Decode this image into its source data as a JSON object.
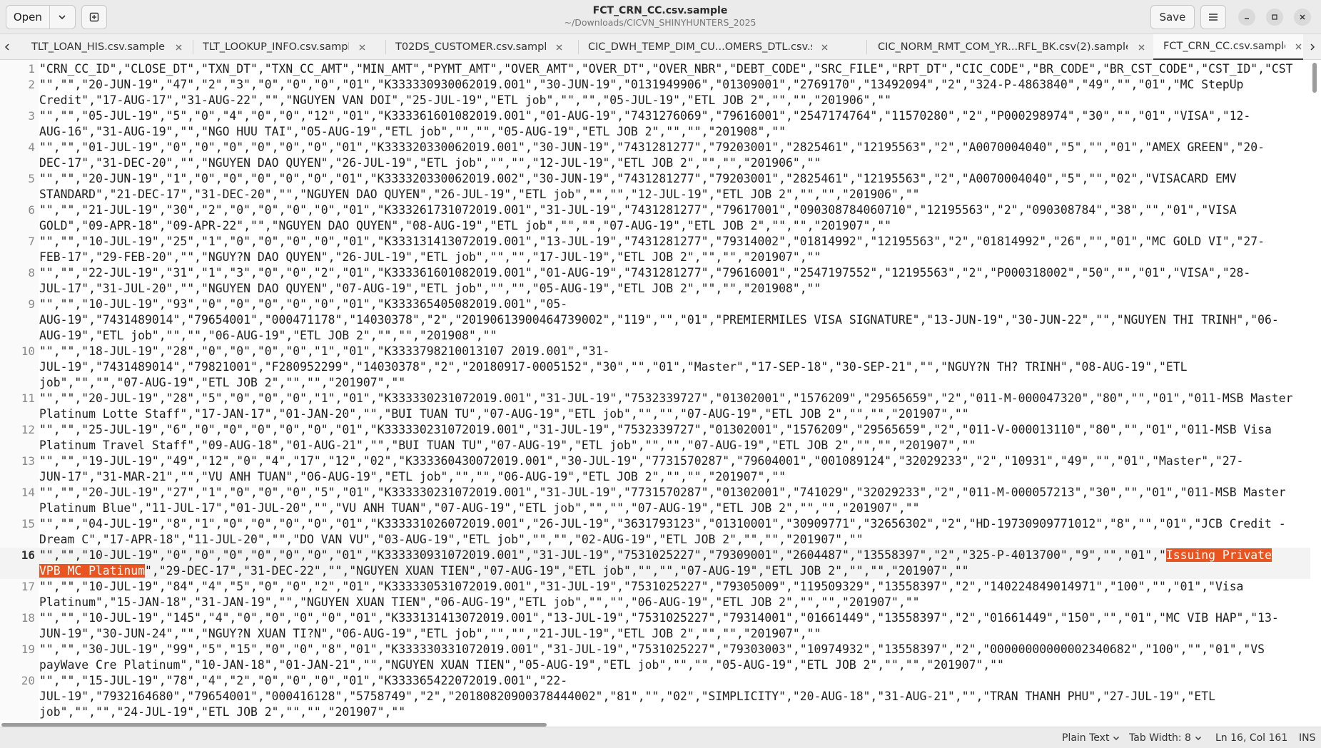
{
  "header": {
    "open_label": "Open",
    "save_label": "Save",
    "title": "FCT_CRN_CC.csv.sample",
    "path": "~/Downloads/CICVN_SHINYHUNTERS_2025"
  },
  "tabs": [
    {
      "label": "TLT_LOAN_HIS.csv.sample",
      "active": false
    },
    {
      "label": "TLT_LOOKUP_INFO.csv.sample",
      "active": false
    },
    {
      "label": "T02DS_CUSTOMER.csv.sample",
      "active": false
    },
    {
      "label": "CIC_DWH_TEMP_DIM_CU...OMERS_DTL.csv.sample",
      "active": false
    },
    {
      "label": "CIC_NORM_RMT_COM_YR...RFL_BK.csv(2).sample",
      "active": false
    },
    {
      "label": "FCT_CRN_CC.csv.sample",
      "active": true
    }
  ],
  "editor": {
    "current_line": 16,
    "lines": [
      {
        "n": "1",
        "segs": [
          "\"CRN_CC_ID\",\"CLOSE_DT\",\"TXN_DT\",\"TXN_CC_AMT\",\"MIN_AMT\",\"PYMT_AMT\",\"OVER_AMT\",\"OVER_DT\",\"OVER_NBR\",\"DEBT_CODE\",\"SRC_FILE\",\"RPT_DT\",\"CIC_CODE\",\"BR_CODE\",\"BR_CST_CODE\",\"CST_ID\",\"CST"
        ]
      },
      {
        "n": "2",
        "segs": [
          "\"\",\"\",\"20-JUN-19\",\"47\",\"2\",\"3\",\"0\",\"0\",\"0\",\"01\",\"K333330930062019.001\",\"30-JUN-19\",\"0131949906\",\"01309001\",\"2769170\",\"13492094\",\"2\",\"324-P-4863840\",\"49\",\"\",\"01\",\"MC StepUp",
          "Credit\",\"17-AUG-17\",\"31-AUG-22\",\"\",\"NGUYEN VAN DOI\",\"25-JUL-19\",\"ETL job\",\"\",\"\",\"05-JUL-19\",\"ETL JOB 2\",\"\",\"\",\"201906\",\"\""
        ]
      },
      {
        "n": "3",
        "segs": [
          "\"\",\"\",\"05-JUL-19\",\"5\",\"0\",\"4\",\"0\",\"0\",\"12\",\"01\",\"K333361601082019.001\",\"01-AUG-19\",\"7431276069\",\"79616001\",\"2547174764\",\"11570280\",\"2\",\"P000298974\",\"30\",\"\",\"01\",\"VISA\",\"12-",
          "AUG-16\",\"31-AUG-19\",\"\",\"NGO HUU TAI\",\"05-AUG-19\",\"ETL job\",\"\",\"\",\"05-AUG-19\",\"ETL JOB 2\",\"\",\"\",\"201908\",\"\""
        ]
      },
      {
        "n": "4",
        "segs": [
          "\"\",\"\",\"01-JUL-19\",\"0\",\"0\",\"0\",\"0\",\"0\",\"0\",\"01\",\"K333320330062019.001\",\"30-JUN-19\",\"7431281277\",\"79203001\",\"2825461\",\"12195563\",\"2\",\"A0070004040\",\"5\",\"\",\"01\",\"AMEX GREEN\",\"20-",
          "DEC-17\",\"31-DEC-20\",\"\",\"NGUYEN DAO QUYEN\",\"26-JUL-19\",\"ETL job\",\"\",\"\",\"12-JUL-19\",\"ETL JOB 2\",\"\",\"\",\"201906\",\"\""
        ]
      },
      {
        "n": "5",
        "segs": [
          "\"\",\"\",\"20-JUN-19\",\"1\",\"0\",\"0\",\"0\",\"0\",\"0\",\"01\",\"K333320330062019.002\",\"30-JUN-19\",\"7431281277\",\"79203001\",\"2825461\",\"12195563\",\"2\",\"A0070004040\",\"5\",\"\",\"02\",\"VISACARD EMV",
          "STANDARD\",\"21-DEC-17\",\"31-DEC-20\",\"\",\"NGUYEN DAO QUYEN\",\"26-JUL-19\",\"ETL job\",\"\",\"\",\"12-JUL-19\",\"ETL JOB 2\",\"\",\"\",\"201906\",\"\""
        ]
      },
      {
        "n": "6",
        "segs": [
          "\"\",\"\",\"21-JUL-19\",\"30\",\"2\",\"0\",\"0\",\"0\",\"0\",\"01\",\"K333261731072019.001\",\"31-JUL-19\",\"7431281277\",\"79617001\",\"090308784060710\",\"12195563\",\"2\",\"090308784\",\"38\",\"\",\"01\",\"VISA",
          "GOLD\",\"09-APR-18\",\"09-APR-22\",\"\",\"NGUYEN DAO QUYEN\",\"08-AUG-19\",\"ETL job\",\"\",\"\",\"07-AUG-19\",\"ETL JOB 2\",\"\",\"\",\"201907\",\"\""
        ]
      },
      {
        "n": "7",
        "segs": [
          "\"\",\"\",\"10-JUL-19\",\"25\",\"1\",\"0\",\"0\",\"0\",\"0\",\"01\",\"K333131413072019.001\",\"13-JUL-19\",\"7431281277\",\"79314002\",\"01814992\",\"12195563\",\"2\",\"01814992\",\"26\",\"\",\"01\",\"MC GOLD VI\",\"27-",
          "FEB-17\",\"29-FEB-20\",\"\",\"NGUY?N DAO QUYEN\",\"26-JUL-19\",\"ETL job\",\"\",\"\",\"17-JUL-19\",\"ETL JOB 2\",\"\",\"\",\"201907\",\"\""
        ]
      },
      {
        "n": "8",
        "segs": [
          "\"\",\"\",\"22-JUL-19\",\"31\",\"1\",\"3\",\"0\",\"0\",\"2\",\"01\",\"K333361601082019.001\",\"01-AUG-19\",\"7431281277\",\"79616001\",\"2547197552\",\"12195563\",\"2\",\"P000318002\",\"50\",\"\",\"01\",\"VISA\",\"28-",
          "JUL-17\",\"31-JUL-20\",\"\",\"NGUYEN DAO QUYEN\",\"07-AUG-19\",\"ETL job\",\"\",\"\",\"05-AUG-19\",\"ETL JOB 2\",\"\",\"\",\"201908\",\"\""
        ]
      },
      {
        "n": "9",
        "segs": [
          "\"\",\"\",\"10-JUL-19\",\"93\",\"0\",\"0\",\"0\",\"0\",\"0\",\"01\",\"K333365405082019.001\",\"05-",
          "AUG-19\",\"7431489014\",\"79654001\",\"000471178\",\"14030378\",\"2\",\"20190613900464739002\",\"119\",\"\",\"01\",\"PREMIERMILES VISA SIGNATURE\",\"13-JUN-19\",\"30-JUN-22\",\"\",\"NGUYEN THI TRINH\",\"06-",
          "AUG-19\",\"ETL job\",\"\",\"\",\"06-AUG-19\",\"ETL JOB 2\",\"\",\"\",\"201908\",\"\""
        ]
      },
      {
        "n": "10",
        "segs": [
          "\"\",\"\",\"18-JUL-19\",\"28\",\"0\",\"0\",\"0\",\"0\",\"1\",\"01\",\"K3333798210013107 2019.001\",\"31-",
          "JUL-19\",\"7431489014\",\"79821001\",\"F280952299\",\"14030378\",\"2\",\"20180917-0005152\",\"30\",\"\",\"01\",\"Master\",\"17-SEP-18\",\"30-SEP-21\",\"\",\"NGUY?N TH? TRINH\",\"08-AUG-19\",\"ETL",
          "job\",\"\",\"\",\"07-AUG-19\",\"ETL JOB 2\",\"\",\"\",\"201907\",\"\""
        ]
      },
      {
        "n": "11",
        "segs": [
          "\"\",\"\",\"20-JUL-19\",\"28\",\"5\",\"0\",\"0\",\"0\",\"1\",\"01\",\"K333330231072019.001\",\"31-JUL-19\",\"7532339727\",\"01302001\",\"1576209\",\"29565659\",\"2\",\"011-M-000047320\",\"80\",\"\",\"01\",\"011-MSB Master",
          "Platinum Lotte Staff\",\"17-JAN-17\",\"01-JAN-20\",\"\",\"BUI TUAN TU\",\"07-AUG-19\",\"ETL job\",\"\",\"\",\"07-AUG-19\",\"ETL JOB 2\",\"\",\"\",\"201907\",\"\""
        ]
      },
      {
        "n": "12",
        "segs": [
          "\"\",\"\",\"25-JUL-19\",\"6\",\"0\",\"0\",\"0\",\"0\",\"0\",\"01\",\"K333330231072019.001\",\"31-JUL-19\",\"7532339727\",\"01302001\",\"1576209\",\"29565659\",\"2\",\"011-V-000013110\",\"80\",\"\",\"01\",\"011-MSB Visa",
          "Platinum Travel Staff\",\"09-AUG-18\",\"01-AUG-21\",\"\",\"BUI TUAN TU\",\"07-AUG-19\",\"ETL job\",\"\",\"\",\"07-AUG-19\",\"ETL JOB 2\",\"\",\"\",\"201907\",\"\""
        ]
      },
      {
        "n": "13",
        "segs": [
          "\"\",\"\",\"19-JUL-19\",\"49\",\"12\",\"0\",\"4\",\"17\",\"12\",\"02\",\"K333360430072019.001\",\"30-JUL-19\",\"7731570287\",\"79604001\",\"001089124\",\"32029233\",\"2\",\"10931\",\"49\",\"\",\"01\",\"Master\",\"27-",
          "JUN-17\",\"31-MAR-21\",\"\",\"VU ANH TUAN\",\"06-AUG-19\",\"ETL job\",\"\",\"\",\"06-AUG-19\",\"ETL JOB 2\",\"\",\"\",\"201907\",\"\""
        ]
      },
      {
        "n": "14",
        "segs": [
          "\"\",\"\",\"20-JUL-19\",\"27\",\"1\",\"0\",\"0\",\"0\",\"5\",\"01\",\"K333330231072019.001\",\"31-JUL-19\",\"7731570287\",\"01302001\",\"741029\",\"32029233\",\"2\",\"011-M-000057213\",\"30\",\"\",\"01\",\"011-MSB Master",
          "Platinum Blue\",\"11-JUL-17\",\"01-JUL-20\",\"\",\"VU ANH TUAN\",\"07-AUG-19\",\"ETL job\",\"\",\"\",\"07-AUG-19\",\"ETL JOB 2\",\"\",\"\",\"201907\",\"\""
        ]
      },
      {
        "n": "15",
        "segs": [
          "\"\",\"\",\"04-JUL-19\",\"8\",\"1\",\"0\",\"0\",\"0\",\"0\",\"01\",\"K333331026072019.001\",\"26-JUL-19\",\"3631793123\",\"01310001\",\"30909771\",\"32656302\",\"2\",\"HD-19730909771012\",\"8\",\"\",\"01\",\"JCB Credit -",
          "Dream C\",\"17-APR-18\",\"11-JUL-20\",\"\",\"DO VAN VU\",\"03-AUG-19\",\"ETL job\",\"\",\"\",\"02-AUG-19\",\"ETL JOB 2\",\"\",\"\",\"201907\",\"\""
        ]
      },
      {
        "n": "16",
        "segs": [
          "\"\",\"\",\"10-JUL-19\",\"0\",\"0\",\"0\",\"0\",\"0\",\"0\",\"01\",\"K333330931072019.001\",\"31-JUL-19\",\"7531025227\",\"79309001\",\"2604487\",\"13558397\",\"2\",\"325-P-4013700\",\"9\",\"\",\"01\",\"",
          "\",\"29-DEC-17\",\"31-DEC-22\",\"\",\"NGUYEN XUAN TIEN\",\"07-AUG-19\",\"ETL job\",\"\",\"\",\"07-AUG-19\",\"ETL JOB 2\",\"\",\"\",\"201907\",\"\""
        ],
        "hl": [
          "Issuing Private",
          "VPB MC Platinum"
        ]
      },
      {
        "n": "17",
        "segs": [
          "\"\",\"\",\"10-JUL-19\",\"84\",\"4\",\"5\",\"0\",\"0\",\"2\",\"01\",\"K333330531072019.001\",\"31-JUL-19\",\"7531025227\",\"79305009\",\"119509329\",\"13558397\",\"2\",\"140224849014971\",\"100\",\"\",\"01\",\"Visa",
          "Platinum\",\"15-JAN-18\",\"31-JAN-19\",\"\",\"NGUYEN XUAN TIEN\",\"06-AUG-19\",\"ETL job\",\"\",\"\",\"06-AUG-19\",\"ETL JOB 2\",\"\",\"\",\"201907\",\"\""
        ]
      },
      {
        "n": "18",
        "segs": [
          "\"\",\"\",\"10-JUL-19\",\"145\",\"4\",\"0\",\"0\",\"0\",\"0\",\"01\",\"K333131413072019.001\",\"13-JUL-19\",\"7531025227\",\"79314001\",\"01661449\",\"13558397\",\"2\",\"01661449\",\"150\",\"\",\"01\",\"MC VIB HAP\",\"13-",
          "JUN-19\",\"30-JUN-24\",\"\",\"NGUY?N XUAN TI?N\",\"06-AUG-19\",\"ETL job\",\"\",\"\",\"21-JUL-19\",\"ETL JOB 2\",\"\",\"\",\"201907\",\"\""
        ]
      },
      {
        "n": "19",
        "segs": [
          "\"\",\"\",\"30-JUL-19\",\"99\",\"5\",\"15\",\"0\",\"0\",\"8\",\"01\",\"K333330331072019.001\",\"31-JUL-19\",\"7531025227\",\"79303003\",\"10974932\",\"13558397\",\"2\",\"00000000000002340682\",\"100\",\"\",\"01\",\"VS",
          "payWave Cre Platinum\",\"10-JAN-18\",\"01-JAN-21\",\"\",\"NGUYEN XUAN TIEN\",\"05-AUG-19\",\"ETL job\",\"\",\"\",\"05-AUG-19\",\"ETL JOB 2\",\"\",\"\",\"201907\",\"\""
        ]
      },
      {
        "n": "20",
        "segs": [
          "\"\",\"\",\"15-JUL-19\",\"78\",\"4\",\"2\",\"0\",\"0\",\"0\",\"01\",\"K333365422072019.001\",\"22-",
          "JUL-19\",\"7932164680\",\"79654001\",\"000416128\",\"5758749\",\"2\",\"20180820900378444002\",\"81\",\"\",\"02\",\"SIMPLICITY\",\"20-AUG-18\",\"31-AUG-21\",\"\",\"TRAN THANH PHU\",\"27-JUL-19\",\"ETL",
          "job\",\"\",\"\",\"24-JUL-19\",\"ETL JOB 2\",\"\",\"\",\"201907\",\"\""
        ]
      }
    ]
  },
  "status": {
    "language": "Plain Text",
    "tab_width": "Tab Width: 8",
    "position": "Ln 16, Col 161",
    "mode": "INS"
  }
}
